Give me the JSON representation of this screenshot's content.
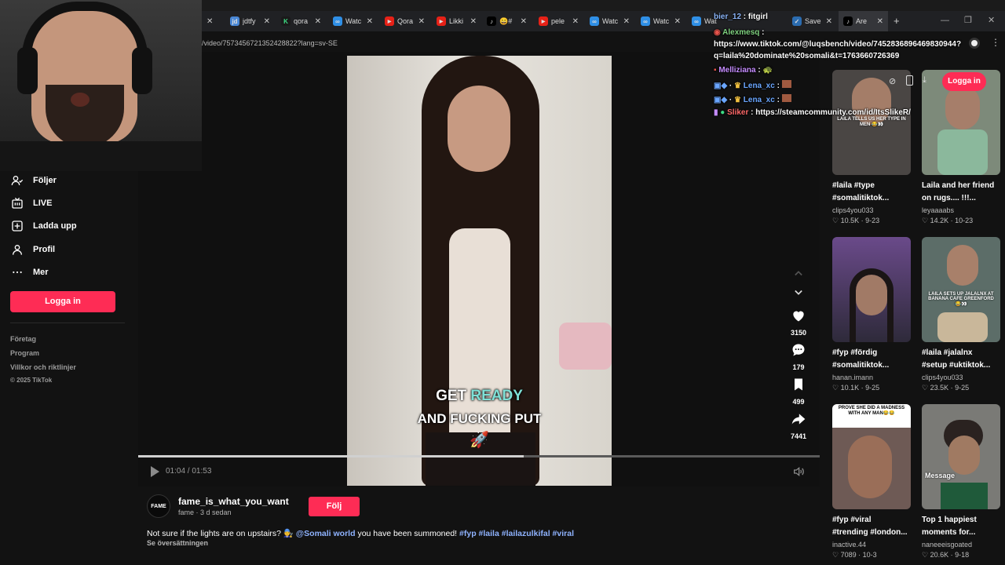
{
  "browser": {
    "tabs": [
      {
        "label": "jdtfy",
        "icon": "jd"
      },
      {
        "label": "qora",
        "icon": "K"
      },
      {
        "label": "Watc",
        "icon": "∞"
      },
      {
        "label": "Qora",
        "icon": "▶"
      },
      {
        "label": "Likki",
        "icon": "▶"
      },
      {
        "label": "😀#",
        "icon": "♪"
      },
      {
        "label": "pele",
        "icon": "▶"
      },
      {
        "label": "Watc",
        "icon": "∞"
      },
      {
        "label": "Watc",
        "icon": "∞"
      },
      {
        "label": "Wat",
        "icon": "∞"
      },
      {
        "label": "Save",
        "icon": "✓"
      },
      {
        "label": "Are",
        "icon": "♪"
      }
    ],
    "url": "/video/7573456721352428822?lang=sv-SE"
  },
  "sidebar": {
    "items": [
      {
        "label": "Följer"
      },
      {
        "label": "LIVE"
      },
      {
        "label": "Ladda upp"
      },
      {
        "label": "Profil"
      },
      {
        "label": "Mer"
      }
    ],
    "login": "Logga in",
    "footer": [
      "Företag",
      "Program",
      "Villkor och riktlinjer",
      "© 2025 TikTok"
    ]
  },
  "video": {
    "caption_line1_a": "GET",
    "caption_line1_b": "READY",
    "caption_line2": "AND FUCKING PUT",
    "caption_emoji": "🚀",
    "time": "01:04 / 01:53",
    "progress": 0.566
  },
  "actions": {
    "likes": "3150",
    "comments": "179",
    "saves": "499",
    "shares": "7441"
  },
  "post": {
    "avatar_text": "FAME",
    "username": "fame_is_what_you_want",
    "meta": "fame · 3 d sedan",
    "follow": "Följ",
    "desc_prefix": "Not sure if the lights are on upstairs? 🧑‍🔧",
    "mention": "@Somali world",
    "desc_mid": "you have been summoned!",
    "tags": [
      "#fyp",
      "#laila",
      "#lailazulkifal",
      "#viral"
    ],
    "translate": "Se översättningen"
  },
  "right": {
    "login": "Logga in",
    "cards": [
      {
        "title1": "#laila #type",
        "title2": "#somalitiktok...",
        "author": "clips4you033",
        "likes": "10.5K",
        "date": "9-23",
        "overlay": "LAILA TELLS US HER TYPE IN MEN 😂👀",
        "bg": "#4a4644"
      },
      {
        "title1": "Laila and her friend",
        "title2": "on rugs.... !!!...",
        "author": "leyaaaabs",
        "likes": "14.2K",
        "date": "10-23",
        "overlay": "",
        "bg": "#7d8a7a"
      },
      {
        "title1": "#fyp #fördig",
        "title2": "#somalitiktok...",
        "author": "hanan.imann",
        "likes": "10.1K",
        "date": "9-25",
        "overlay": "",
        "bg": "#3e3a52"
      },
      {
        "title1": "#laila #jalalnx",
        "title2": "#setup #uktiktok...",
        "author": "clips4you033",
        "likes": "23.5K",
        "date": "9-25",
        "overlay": "LAILA SETS UP JALALNX AT BANANA CAFE GREENFORD 😂👀",
        "bg": "#5c6d68"
      },
      {
        "title1": "#fyp #viral",
        "title2": "#trending #london...",
        "author": "inactive.44",
        "likes": "7089",
        "date": "10-3",
        "overlay": "PROVE SHE DID A MADNESS WITH ANY MAN😂😂",
        "bg": "#6e5a55"
      },
      {
        "title1": "Top 1 happiest",
        "title2": "moments for...",
        "author": "naneeeisgoated",
        "likes": "20.6K",
        "date": "9-18",
        "overlay": "Message",
        "bg": "#7a7a76"
      }
    ]
  },
  "chat": [
    {
      "user": "bier_12",
      "text": "fitgirl",
      "color": "#8ab4f8"
    },
    {
      "user": "Alexmesq",
      "text": "",
      "color": "#7fd17f"
    },
    {
      "user": "",
      "text": "https://www.tiktok.com/@luqsbench/video/7452836896469830944?",
      "color": "#ffffff"
    },
    {
      "user": "",
      "text": "q=laila%20dominate%20somali&t=1763660726369",
      "color": "#ffffff"
    },
    {
      "user": "Melliziana",
      "text": "🐢",
      "color": "#c58cff"
    },
    {
      "user": "Lena_xc",
      "text": "",
      "color": "#6aa6ff"
    },
    {
      "user": "Lena_xc",
      "text": "",
      "color": "#6aa6ff"
    },
    {
      "user": "Sliker",
      "text": "https://steamcommunity.com/id/ItsSlikeR/",
      "color": "#ff6a6a"
    }
  ],
  "colors": {
    "accent": "#fe2c55",
    "link": "#8fb3ff"
  }
}
